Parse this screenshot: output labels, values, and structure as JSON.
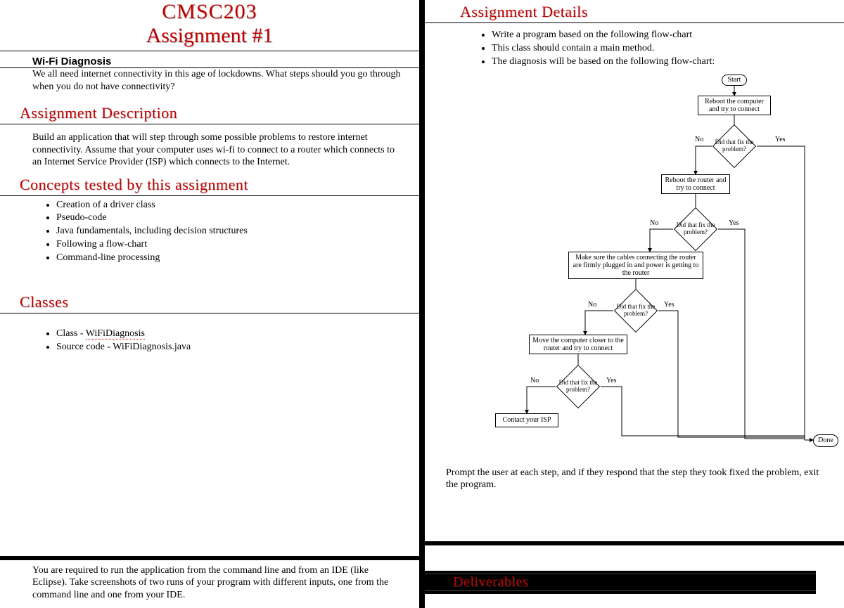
{
  "left": {
    "title": "CMSC203",
    "subtitle": "Assignment #1",
    "topic_head": "Wi-Fi Diagnosis",
    "topic_body": "We all need internet connectivity in this age of lockdowns.  What steps should you go through when you do not have connectivity?",
    "desc_head": "Assignment Description",
    "desc_body": "Build an application that will step through some possible problems to restore internet connectivity.  Assume that your computer uses wi-fi to connect to a router which connects to an Internet Service Provider (ISP) which connects to the Internet.",
    "concepts_head": "Concepts tested by this assignment",
    "concepts": [
      "Creation of a driver class",
      "Pseudo-code",
      "Java fundamentals, including decision structures",
      "Following a flow-chart",
      "Command-line processing"
    ],
    "classes_head": "Classes",
    "class_item_prefix": "Class - ",
    "class_item_link": "WiFiDiagnosis",
    "class_item2": "Source code - WiFiDiagnosis.java",
    "footer": "You are required to run the application from the command line and from an IDE (like Eclipse). Take screenshots of two runs of your program with different inputs, one from the command line and one from your IDE."
  },
  "right": {
    "details_head": "Assignment Details",
    "details_list": [
      "Write a program based on the following flow-chart",
      "This class should contain a main method.",
      "The diagnosis will be based on the following flow-chart:"
    ],
    "flow": {
      "start": "Start",
      "step1": "Reboot the computer and try to connect",
      "q": "Did that fix the problem?",
      "step2": "Reboot the router and try to connect",
      "step3": "Make sure the cables connecting the router are firmly plugged in and power is getting to the router",
      "step4": "Move the computer closer to the router and try to connect",
      "step5": "Contact your ISP",
      "done": "Done",
      "no": "No",
      "yes": "Yes"
    },
    "prompt_text": "Prompt the user at each step, and if they respond that the step they took fixed the problem, exit the program.",
    "deliverables": "Deliverables"
  }
}
